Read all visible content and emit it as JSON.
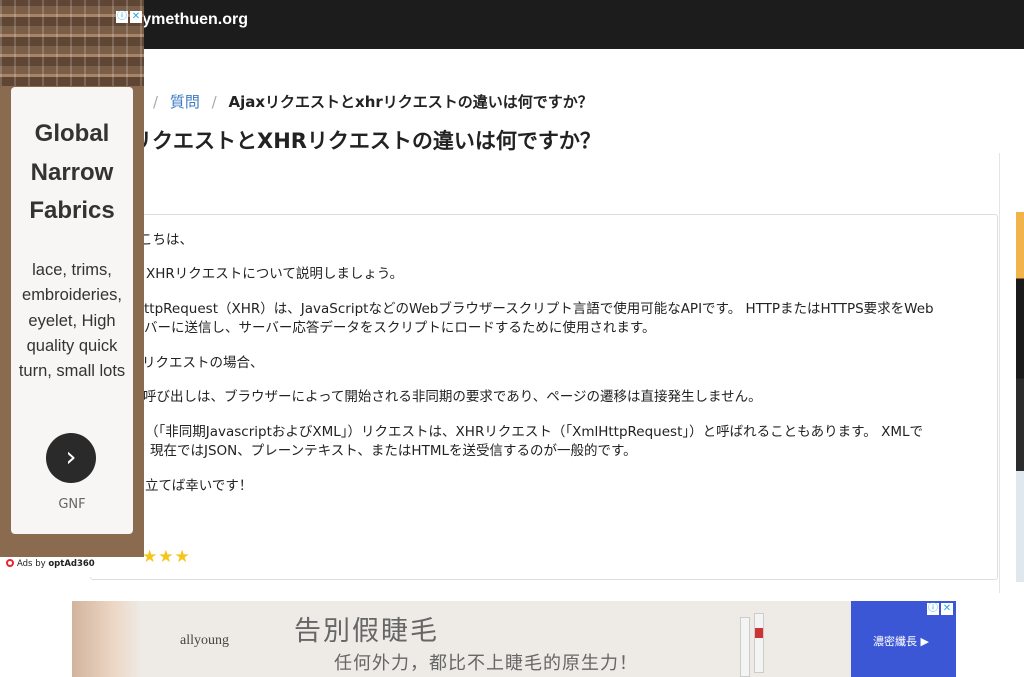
{
  "header": {
    "site_name": "rymethuen.org"
  },
  "breadcrumb": {
    "separator": "/",
    "link": "質問",
    "current": "Ajaxリクエストとxhrリクエストの違いは何ですか？"
  },
  "page_title": "リクエストとXHRリクエストの違いは何ですか？",
  "answer": {
    "paragraphs": [
      "こちは、",
      "XHRリクエストについて説明しましょう。",
      "ttpRequest（XHR）は、JavaScriptなどのWebブラウザースクリプト言語で使用可能なAPIです。 HTTPまたはHTTPS要求をWeb",
      "バーに送信し、サーバー応答データをスクリプトにロードするために使用されます。",
      "リクエストの場合、",
      "呼び出しは、ブラウザーによって開始される非同期の要求であり、ページの遷移は直接発生しません。",
      "（「非同期JavascriptおよびXML」）リクエストは、XHRリクエスト（「XmlHttpRequest」）と呼ばれることもあります。 XMLで",
      "現在ではJSON、プレーンテキスト、またはHTMLを送受信するのが一般的です。",
      "立てば幸いです！"
    ],
    "stars": "★★★"
  },
  "left_ad": {
    "headline": "Global Narrow Fabrics",
    "copy": "lace, trims, embroideries, eyelet, High quality quick turn, small lots",
    "arrow": "›",
    "brand": "GNF",
    "info_icon": "ⓘ",
    "close_icon": "✕",
    "ads_by": "Ads by",
    "ads_by_brand": "optAd360"
  },
  "bottom_ad": {
    "logo": "allyoung",
    "headline": "告別假睫毛",
    "subline": "任何外力，都比不上睫毛的原生力！",
    "cta": "濃密纖長 ▶",
    "info_icon": "ⓘ",
    "close_icon": "✕"
  },
  "colors": {
    "topbar": "#1c1c1c",
    "link": "#3d7bc4",
    "star": "#f5c518",
    "cta": "#3b57d6"
  }
}
